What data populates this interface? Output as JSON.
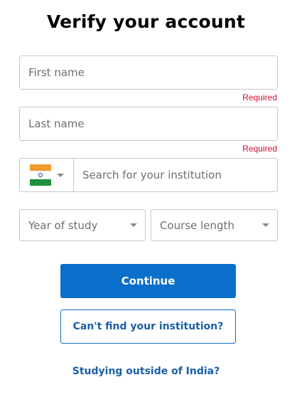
{
  "title": "Verify your account",
  "first_name": {
    "placeholder": "First name",
    "required": "Required"
  },
  "last_name": {
    "placeholder": "Last name",
    "required": "Required"
  },
  "institution": {
    "country_icon": "india-flag-icon",
    "placeholder": "Search for your institution"
  },
  "year_of_study": {
    "placeholder": "Year of study"
  },
  "course_length": {
    "placeholder": "Course length"
  },
  "continue_label": "Continue",
  "cant_find_label": "Can't find your institution?",
  "outside_label": "Studying outside of India?",
  "colors": {
    "primary": "#0a6fcb",
    "link": "#1b5fa8",
    "error": "#c8102e",
    "border": "#c7c7c7"
  }
}
